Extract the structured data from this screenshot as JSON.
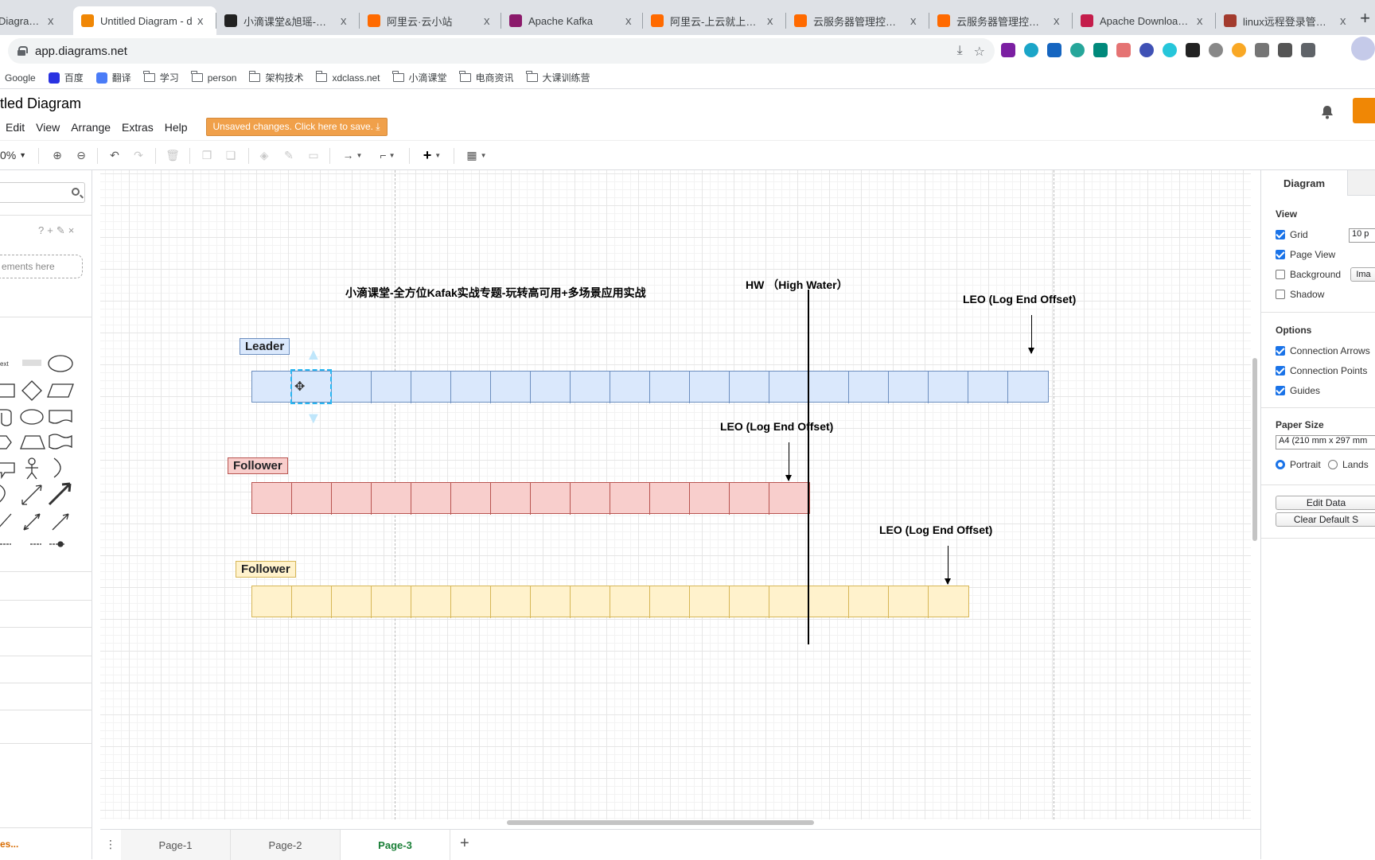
{
  "browser": {
    "tabs": [
      {
        "title": "Diagram - d",
        "favicon_color": "#f08705"
      },
      {
        "title": "Untitled Diagram - d",
        "favicon_color": "#f08705",
        "active": true
      },
      {
        "title": "小滴课堂&旭瑶-首页",
        "favicon_color": "#222222"
      },
      {
        "title": "阿里云·云小站",
        "favicon_color": "#ff6a00"
      },
      {
        "title": "Apache Kafka",
        "favicon_color": "#8b1a6b"
      },
      {
        "title": "阿里云-上云就上阿里",
        "favicon_color": "#ff6a00"
      },
      {
        "title": "云服务器管理控制台",
        "favicon_color": "#ff6a00"
      },
      {
        "title": "云服务器管理控制台",
        "favicon_color": "#ff6a00"
      },
      {
        "title": "Apache Download M",
        "favicon_color": "#c41d4b"
      },
      {
        "title": "linux远程登录管理工",
        "favicon_color": "#a33b2e"
      }
    ],
    "close_glyph": "x",
    "new_tab": "+",
    "url": "app.diagrams.net",
    "bookmarks": [
      {
        "label": "Google",
        "type": "link"
      },
      {
        "label": "百度",
        "type": "link"
      },
      {
        "label": "翻译",
        "type": "link"
      },
      {
        "label": "学习",
        "type": "folder"
      },
      {
        "label": "person",
        "type": "folder"
      },
      {
        "label": "架构技术",
        "type": "folder"
      },
      {
        "label": "xdclass.net",
        "type": "folder"
      },
      {
        "label": "小滴课堂",
        "type": "folder"
      },
      {
        "label": "电商资讯",
        "type": "folder"
      },
      {
        "label": "大课训练营",
        "type": "folder"
      }
    ]
  },
  "app": {
    "title": "itled Diagram",
    "menus": [
      "Edit",
      "View",
      "Arrange",
      "Extras",
      "Help"
    ],
    "save_banner": "Unsaved changes. Click here to save.",
    "zoom": "0%"
  },
  "sidebar": {
    "search_placeholder": "",
    "drop_hint": "ements here",
    "more_shapes": "es..."
  },
  "diagram": {
    "title": "小滴课堂-全方位Kafak实战专题-玩转高可用+多场景应用实战",
    "hw_label": "HW （High Water）",
    "leo_labels": [
      "LEO (Log End Offset)",
      "LEO (Log End Offset)",
      "LEO (Log End Offset)"
    ],
    "rows": [
      {
        "label": "Leader",
        "cells": 20,
        "color": "#dae8fc"
      },
      {
        "label": "Follower",
        "cells": 14,
        "color": "#f8cecc"
      },
      {
        "label": "Follower",
        "cells": 18,
        "color": "#fff2cc"
      }
    ]
  },
  "pages": {
    "tabs": [
      "Page-1",
      "Page-2",
      "Page-3"
    ],
    "active": "Page-3",
    "add": "+"
  },
  "format_panel": {
    "tab": "Diagram",
    "view_heading": "View",
    "view": [
      {
        "label": "Grid",
        "checked": true
      },
      {
        "label": "Page View",
        "checked": true
      },
      {
        "label": "Background",
        "checked": false
      },
      {
        "label": "Shadow",
        "checked": false
      }
    ],
    "grid_size": "10 p",
    "image_button": "Ima",
    "options_heading": "Options",
    "options": [
      {
        "label": "Connection Arrows",
        "checked": true
      },
      {
        "label": "Connection Points",
        "checked": true
      },
      {
        "label": "Guides",
        "checked": true
      }
    ],
    "paper_heading": "Paper Size",
    "paper_value": "A4 (210 mm x 297 mm",
    "orientation": [
      {
        "label": "Portrait",
        "selected": true
      },
      {
        "label": "Lands",
        "selected": false
      }
    ],
    "edit_data": "Edit Data",
    "clear_default": "Clear Default S"
  }
}
